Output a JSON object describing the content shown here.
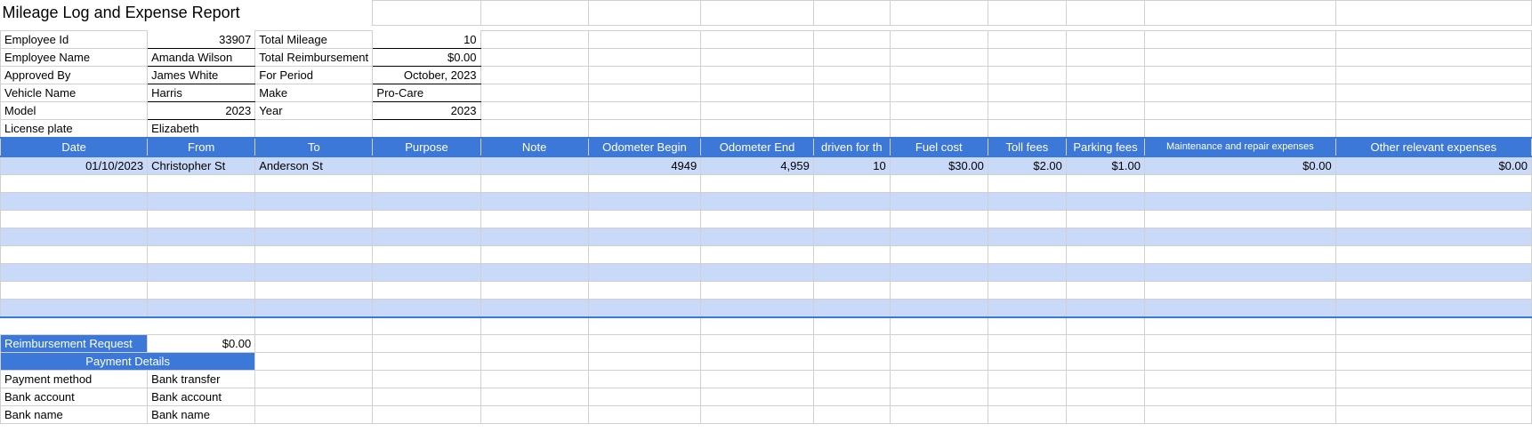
{
  "title": "Mileage Log and Expense Report",
  "info": {
    "employee_id_label": "Employee Id",
    "employee_id": "33907",
    "total_mileage_label": "Total Mileage",
    "total_mileage": "10",
    "employee_name_label": "Employee Name",
    "employee_name": "Amanda Wilson",
    "total_reimb_label": "Total Reimbursement",
    "total_reimb": "$0.00",
    "approved_by_label": "Approved By",
    "approved_by": "James White",
    "for_period_label": "For Period",
    "for_period": "October, 2023",
    "vehicle_name_label": "Vehicle Name",
    "vehicle_name": "Harris",
    "make_label": "Make",
    "make": "Pro-Care",
    "model_label": "Model",
    "model": "2023",
    "year_label": "Year",
    "year": "2023",
    "license_label": "License plate",
    "license": "Elizabeth"
  },
  "columns": {
    "date": "Date",
    "from": "From",
    "to": "To",
    "purpose": "Purpose",
    "note": "Note",
    "odo_begin": "Odometer Begin",
    "odo_end": "Odometer End",
    "driven": "driven for th",
    "fuel": "Fuel cost",
    "toll": "Toll fees",
    "parking": "Parking fees",
    "maint": "Maintenance and repair expenses",
    "other": "Other relevant expenses"
  },
  "row1": {
    "date": "01/10/2023",
    "from": "Christopher St",
    "to": "Anderson St",
    "purpose": "",
    "note": "",
    "odo_begin": "4949",
    "odo_end": "4,959",
    "driven": "10",
    "fuel": "$30.00",
    "toll": "$2.00",
    "parking": "$1.00",
    "maint": "$0.00",
    "other": "$0.00"
  },
  "reimb": {
    "request_label": "Reimbursement Request",
    "request_value": "$0.00",
    "payment_details_header": "Payment Details",
    "pm_label": "Payment method",
    "pm_value": "Bank transfer",
    "ba_label": "Bank account",
    "ba_value": "Bank account",
    "bn_label": "Bank name",
    "bn_value": "Bank name"
  }
}
